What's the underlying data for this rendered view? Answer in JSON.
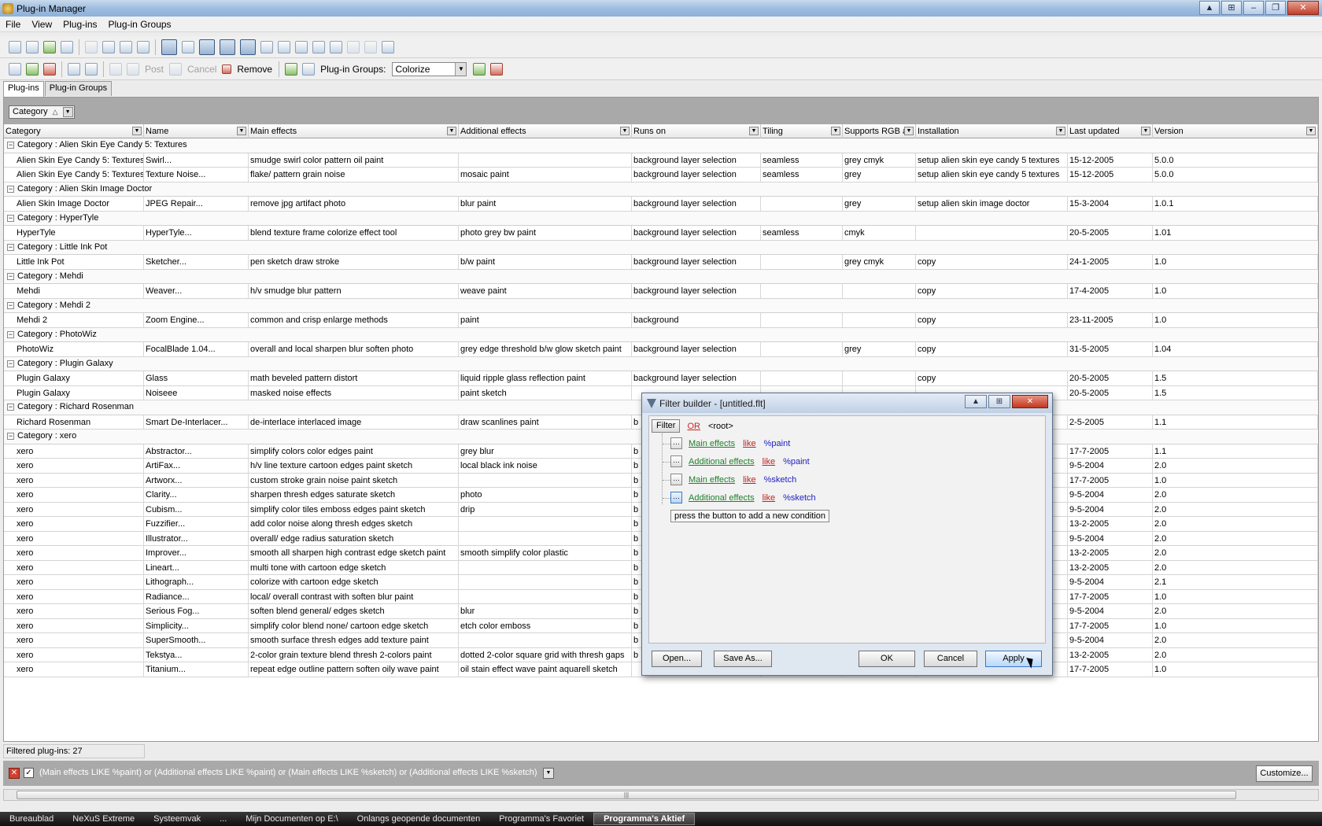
{
  "window": {
    "title": "Plug-in Manager"
  },
  "menu": [
    "File",
    "View",
    "Plug-ins",
    "Plug-in Groups"
  ],
  "toolbar2": {
    "post": "Post",
    "cancel": "Cancel",
    "remove": "Remove",
    "groups_label": "Plug-in Groups:",
    "groups_value": "Colorize"
  },
  "tabs": [
    "Plug-ins",
    "Plug-in Groups"
  ],
  "group_by": {
    "label": "Category"
  },
  "columns": [
    "Category",
    "Name",
    "Main effects",
    "Additional effects",
    "Runs on",
    "Tiling",
    "Supports RGB a",
    "Installation",
    "Last updated",
    "Version"
  ],
  "rows": [
    {
      "type": "group",
      "text": "Category : Alien Skin Eye Candy 5: Textures"
    },
    {
      "type": "row",
      "cells": [
        "Alien Skin Eye Candy 5: Textures",
        "Swirl...",
        "smudge swirl color pattern oil paint",
        "",
        "background layer selection",
        "seamless",
        "grey cmyk",
        "setup alien skin eye candy 5 textures",
        "15-12-2005",
        "5.0.0"
      ]
    },
    {
      "type": "row",
      "cells": [
        "Alien Skin Eye Candy 5: Textures",
        "Texture Noise...",
        "flake/ pattern grain noise",
        "mosaic paint",
        "background layer selection",
        "seamless",
        "grey",
        "setup alien skin eye candy 5 textures",
        "15-12-2005",
        "5.0.0"
      ]
    },
    {
      "type": "group",
      "text": "Category : Alien Skin Image Doctor"
    },
    {
      "type": "row",
      "cells": [
        "Alien Skin Image Doctor",
        "JPEG Repair...",
        "remove jpg artifact photo",
        "blur paint",
        "background layer selection",
        "",
        "grey",
        "setup alien skin image doctor",
        "15-3-2004",
        "1.0.1"
      ]
    },
    {
      "type": "group",
      "text": "Category : HyperTyle"
    },
    {
      "type": "row",
      "cells": [
        "HyperTyle",
        "HyperTyle...",
        "blend texture frame colorize effect tool",
        "photo grey bw paint",
        "background layer selection",
        "seamless",
        "cmyk",
        "",
        "20-5-2005",
        "1.01"
      ]
    },
    {
      "type": "group",
      "text": "Category : Little Ink Pot"
    },
    {
      "type": "row",
      "cells": [
        "Little Ink Pot",
        "Sketcher...",
        "pen sketch draw stroke",
        "b/w paint",
        "background layer selection",
        "",
        "grey cmyk",
        "copy",
        "24-1-2005",
        "1.0"
      ]
    },
    {
      "type": "group",
      "text": "Category : Mehdi"
    },
    {
      "type": "row",
      "cells": [
        "Mehdi",
        "Weaver...",
        "h/v smudge blur pattern",
        "weave paint",
        "background layer selection",
        "",
        "",
        "copy",
        "17-4-2005",
        "1.0"
      ]
    },
    {
      "type": "group",
      "text": "Category : Mehdi 2"
    },
    {
      "type": "row",
      "cells": [
        "Mehdi 2",
        "Zoom Engine...",
        "common and crisp enlarge methods",
        "paint",
        "background",
        "",
        "",
        "copy",
        "23-11-2005",
        "1.0"
      ]
    },
    {
      "type": "group",
      "text": "Category : PhotoWiz"
    },
    {
      "type": "row",
      "cells": [
        "PhotoWiz",
        "FocalBlade 1.04...",
        "overall and local sharpen blur soften photo",
        "grey edge threshold b/w glow sketch paint",
        "background layer selection",
        "",
        "grey",
        "copy",
        "31-5-2005",
        "1.04"
      ]
    },
    {
      "type": "group",
      "text": "Category : Plugin Galaxy"
    },
    {
      "type": "row",
      "cells": [
        "Plugin Galaxy",
        "Glass",
        "math beveled pattern distort",
        "liquid ripple glass reflection paint",
        "background layer selection",
        "",
        "",
        "copy",
        "20-5-2005",
        "1.5"
      ]
    },
    {
      "type": "row",
      "cells": [
        "Plugin Galaxy",
        "Noiseee",
        "masked noise effects",
        "paint sketch",
        "",
        "",
        "",
        "",
        "20-5-2005",
        "1.5"
      ]
    },
    {
      "type": "group",
      "text": "Category : Richard Rosenman"
    },
    {
      "type": "row",
      "cells": [
        "Richard Rosenman",
        "Smart De-Interlacer...",
        "de-interlace interlaced image",
        "draw scanlines paint",
        "b",
        "",
        "",
        "",
        "2-5-2005",
        "1.1"
      ]
    },
    {
      "type": "group",
      "text": "Category : xero"
    },
    {
      "type": "row",
      "cells": [
        "xero",
        "Abstractor...",
        "simplify colors color edges paint",
        "grey blur",
        "b",
        "",
        "",
        "",
        "17-7-2005",
        "1.1"
      ]
    },
    {
      "type": "row",
      "cells": [
        "xero",
        "ArtiFax...",
        "h/v line texture cartoon edges paint sketch",
        "local black ink noise",
        "b",
        "",
        "",
        "",
        "9-5-2004",
        "2.0"
      ]
    },
    {
      "type": "row",
      "cells": [
        "xero",
        "Artworx...",
        "custom stroke grain noise paint sketch",
        "",
        "b",
        "",
        "",
        "",
        "17-7-2005",
        "1.0"
      ]
    },
    {
      "type": "row",
      "cells": [
        "xero",
        "Clarity...",
        "sharpen thresh edges saturate sketch",
        "photo",
        "b",
        "",
        "",
        "",
        "9-5-2004",
        "2.0"
      ]
    },
    {
      "type": "row",
      "cells": [
        "xero",
        "Cubism...",
        "simplify color tiles emboss edges paint sketch",
        "drip",
        "b",
        "",
        "",
        "",
        "9-5-2004",
        "2.0"
      ]
    },
    {
      "type": "row",
      "cells": [
        "xero",
        "Fuzzifier...",
        "add color noise along thresh edges sketch",
        "",
        "b",
        "",
        "",
        "",
        "13-2-2005",
        "2.0"
      ]
    },
    {
      "type": "row",
      "cells": [
        "xero",
        "Illustrator...",
        "overall/ edge radius saturation sketch",
        "",
        "b",
        "",
        "",
        "",
        "9-5-2004",
        "2.0"
      ]
    },
    {
      "type": "row",
      "cells": [
        "xero",
        "Improver...",
        "smooth all sharpen high contrast edge sketch paint",
        "smooth simplify color plastic",
        "b",
        "",
        "",
        "",
        "13-2-2005",
        "2.0"
      ]
    },
    {
      "type": "row",
      "cells": [
        "xero",
        "Lineart...",
        "multi tone with cartoon edge sketch",
        "",
        "b",
        "",
        "",
        "",
        "13-2-2005",
        "2.0"
      ]
    },
    {
      "type": "row",
      "cells": [
        "xero",
        "Lithograph...",
        "colorize with cartoon edge sketch",
        "",
        "b",
        "",
        "",
        "",
        "9-5-2004",
        "2.1"
      ]
    },
    {
      "type": "row",
      "cells": [
        "xero",
        "Radiance...",
        "local/ overall contrast with soften blur paint",
        "",
        "b",
        "",
        "",
        "",
        "17-7-2005",
        "1.0"
      ]
    },
    {
      "type": "row",
      "cells": [
        "xero",
        "Serious Fog...",
        "soften blend general/ edges sketch",
        "blur",
        "b",
        "",
        "",
        "",
        "9-5-2004",
        "2.0"
      ]
    },
    {
      "type": "row",
      "cells": [
        "xero",
        "Simplicity...",
        "simplify color blend none/ cartoon edge sketch",
        "etch color emboss",
        "b",
        "",
        "",
        "",
        "17-7-2005",
        "1.0"
      ]
    },
    {
      "type": "row",
      "cells": [
        "xero",
        "SuperSmooth...",
        "smooth surface thresh edges add texture paint",
        "",
        "b",
        "",
        "",
        "",
        "9-5-2004",
        "2.0"
      ]
    },
    {
      "type": "row",
      "cells": [
        "xero",
        "Tekstya...",
        "2-color grain texture blend thresh 2-colors paint",
        "dotted 2-color square grid with thresh gaps",
        "b",
        "",
        "",
        "",
        "13-2-2005",
        "2.0"
      ]
    },
    {
      "type": "row",
      "cells": [
        "xero",
        "Titanium...",
        "repeat edge outline pattern soften oily wave paint",
        "oil stain effect wave paint aquarell sketch",
        "",
        "",
        "",
        "",
        "17-7-2005",
        "1.0"
      ]
    }
  ],
  "status": {
    "filtered": "Filtered plug-ins: 27"
  },
  "filterbar": {
    "expression": "(Main effects LIKE %paint) or (Additional effects LIKE %paint) or (Main effects LIKE %sketch) or (Additional effects LIKE %sketch)",
    "customize": "Customize..."
  },
  "dialog": {
    "title": "Filter builder - [untitled.flt]",
    "filter_label": "Filter",
    "operator": "OR",
    "root": "<root>",
    "conditions": [
      {
        "field": "Main effects",
        "op": "like",
        "value": "%paint"
      },
      {
        "field": "Additional effects",
        "op": "like",
        "value": "%paint"
      },
      {
        "field": "Main effects",
        "op": "like",
        "value": "%sketch"
      },
      {
        "field": "Additional effects",
        "op": "like",
        "value": "%sketch"
      }
    ],
    "hint": "press the button to add a new condition",
    "open": "Open...",
    "save_as": "Save As...",
    "ok": "OK",
    "cancel": "Cancel",
    "apply": "Apply"
  },
  "taskbar": [
    "Bureaublad",
    "NeXuS Extreme",
    "Systeemvak",
    "...",
    "Mijn Documenten op E:\\",
    "Onlangs geopende documenten",
    "Programma's Favoriet",
    "Programma's Aktief"
  ]
}
